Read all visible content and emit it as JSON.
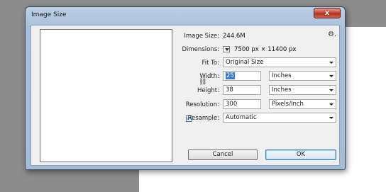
{
  "window": {
    "title": "Image Size",
    "close_glyph": "x"
  },
  "fields": {
    "image_size_label": "Image Size:",
    "image_size_value": "244.6M",
    "dimensions_label": "Dimensions:",
    "dimensions_value": "7500 px  ×  11400 px",
    "fit_to_label": "Fit To:",
    "fit_to_value": "Original Size",
    "width_label": "Width:",
    "width_value": "25",
    "width_unit": "Inches",
    "height_label": "Height:",
    "height_value": "38",
    "height_unit": "Inches",
    "resolution_label": "Resolution:",
    "resolution_value": "300",
    "resolution_unit": "Pixels/Inch",
    "resample_label": "Resample:",
    "resample_checked": true,
    "resample_value": "Automatic"
  },
  "buttons": {
    "cancel": "Cancel",
    "ok": "OK"
  },
  "icons": {
    "gear": "gear-icon",
    "link": "link-icon",
    "dimensions_dropdown": "dropdown-icon"
  },
  "colors": {
    "selection": "#3a78d4",
    "close_button": "#c9473a",
    "titlebar": "#bcd0e6"
  }
}
